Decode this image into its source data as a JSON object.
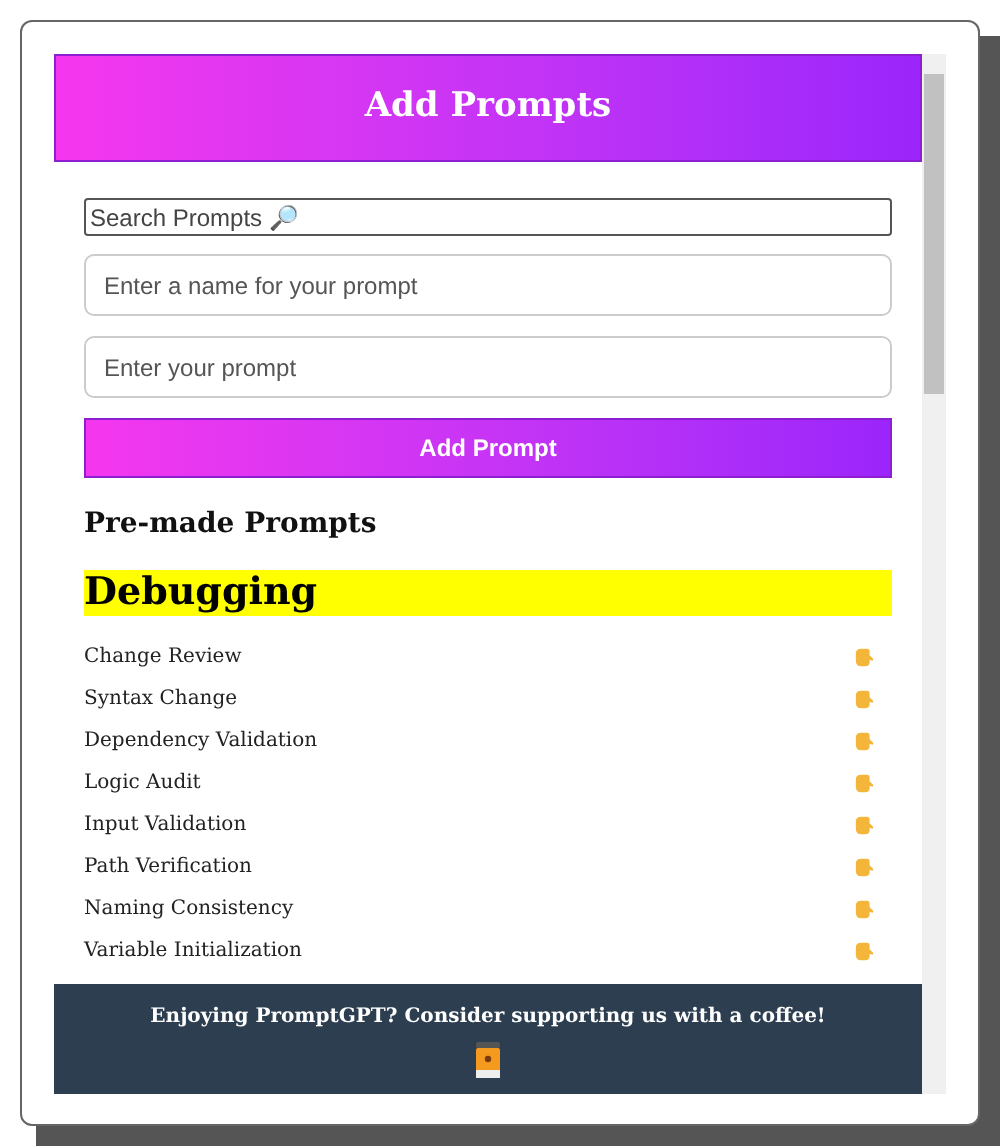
{
  "header": {
    "title": "Add Prompts"
  },
  "search": {
    "placeholder": "Search Prompts 🔎"
  },
  "name_field": {
    "placeholder": "Enter a name for your prompt"
  },
  "prompt_field": {
    "placeholder": "Enter your prompt"
  },
  "add_button": "Add Prompt",
  "section_title": "Pre-made Prompts",
  "category": "Debugging",
  "prompts": [
    {
      "name": "Change Review"
    },
    {
      "name": "Syntax Change"
    },
    {
      "name": "Dependency Validation"
    },
    {
      "name": "Logic Audit"
    },
    {
      "name": "Input Validation"
    },
    {
      "name": "Path Verification"
    },
    {
      "name": "Naming Consistency"
    },
    {
      "name": "Variable Initialization"
    }
  ],
  "footer": {
    "text": "Enjoying PromptGPT? Consider supporting us with a coffee!"
  }
}
